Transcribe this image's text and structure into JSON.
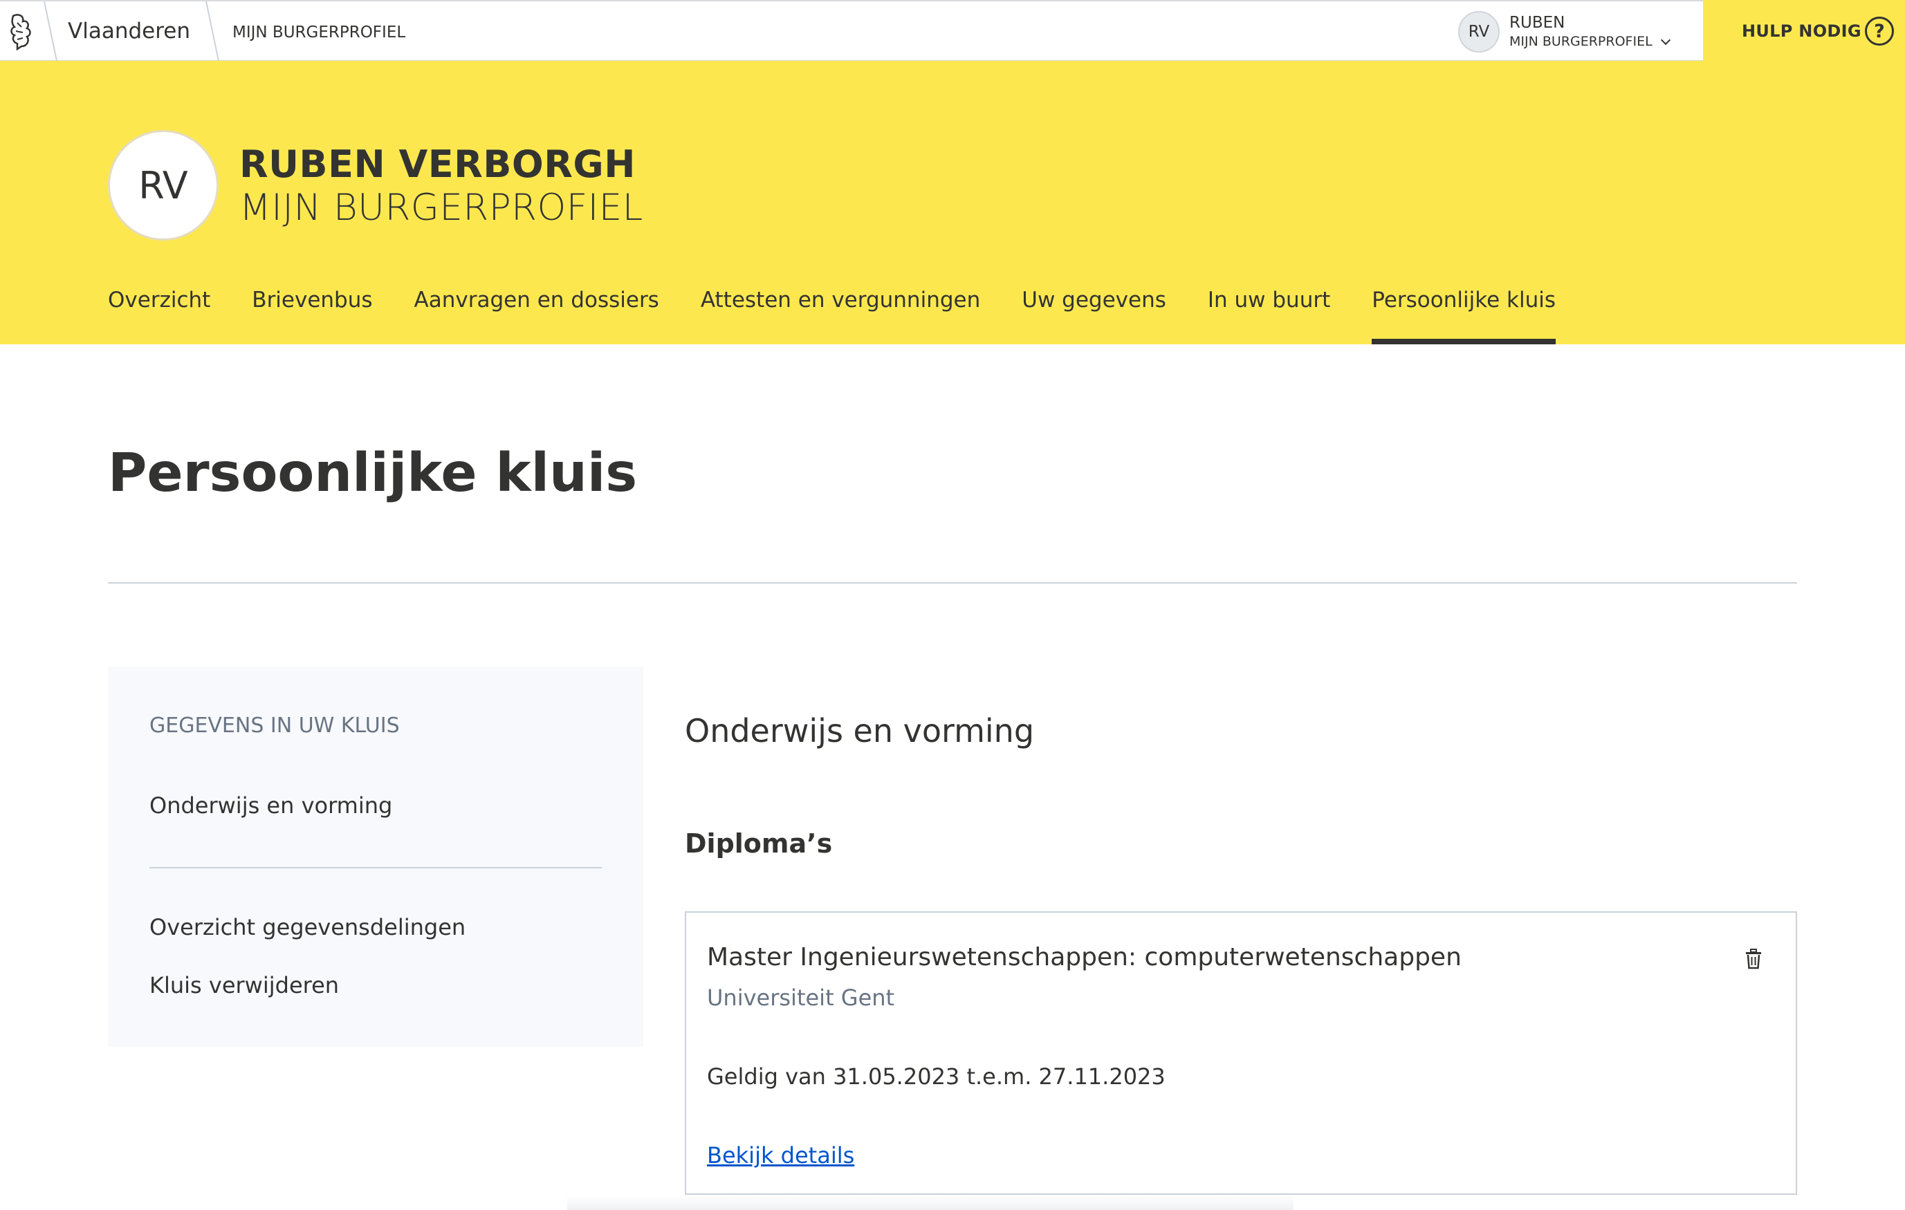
{
  "topbar": {
    "brand": "Vlaanderen",
    "profile": "MIJN BURGERPROFIEL",
    "user_initials": "RV",
    "user_name": "RUBEN",
    "user_sub": "MIJN BURGERPROFIEL",
    "help_label": "HULP NODIG",
    "help_icon_glyph": "?"
  },
  "header": {
    "initials": "RV",
    "name": "RUBEN VERBORGH",
    "subtitle": "MIJN BURGERPROFIEL",
    "background": "#fce84e",
    "tabs": [
      {
        "label": "Overzicht"
      },
      {
        "label": "Brievenbus"
      },
      {
        "label": "Aanvragen en dossiers"
      },
      {
        "label": "Attesten en vergunningen"
      },
      {
        "label": "Uw gegevens"
      },
      {
        "label": "In uw buurt"
      },
      {
        "label": "Persoonlijke kluis",
        "active": true
      }
    ]
  },
  "main": {
    "page_title": "Persoonlijke kluis",
    "sidebar": {
      "heading": "GEGEVENS IN UW KLUIS",
      "active_item": "Onderwijs en vorming",
      "links": [
        "Overzicht gegevensdelingen",
        "Kluis verwijderen"
      ]
    },
    "section_title": "Onderwijs en vorming",
    "subsection_title": "Diploma’s",
    "diploma": {
      "title": "Master Ingenieurswetenschappen: computerwetenschappen",
      "institution": "Universiteit Gent",
      "validity": "Geldig van 31.05.2023 t.e.m. 27.11.2023",
      "link": "Bekijk details",
      "link_color": "#0055cc"
    }
  }
}
